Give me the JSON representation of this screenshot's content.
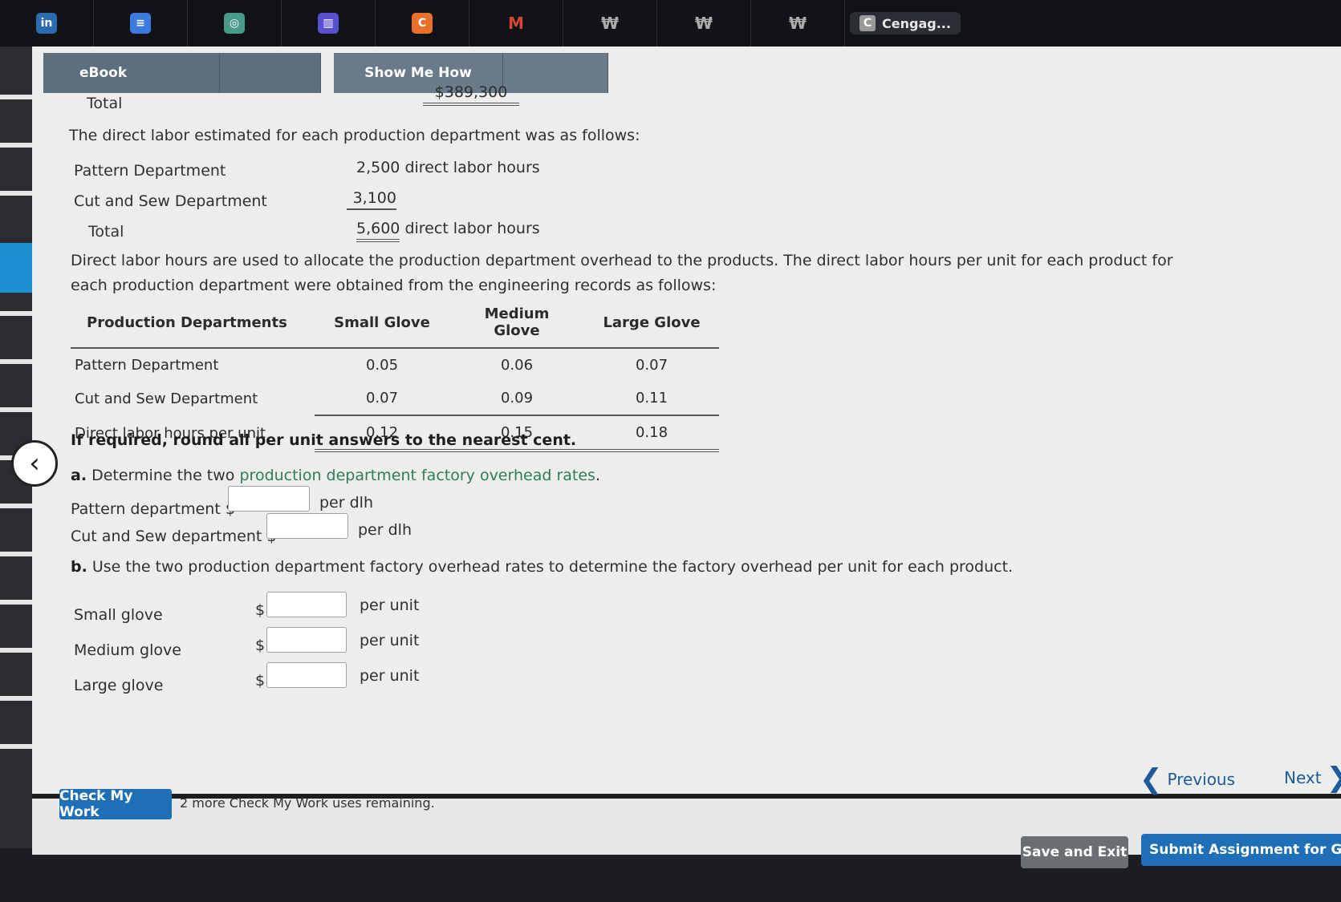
{
  "browser_tabs": {
    "icons": [
      {
        "name": "linkedin-icon",
        "glyph": "in",
        "color": "#2b6cb0"
      },
      {
        "name": "docs-icon",
        "glyph": "≡",
        "color": "#3b7be0"
      },
      {
        "name": "chatgpt-icon",
        "glyph": "◎",
        "color": "#4a9a8a"
      },
      {
        "name": "audio-icon",
        "glyph": "▥",
        "color": "#5a4fcf"
      },
      {
        "name": "cengage-orange-icon",
        "glyph": "C",
        "color": "#e8702a"
      },
      {
        "name": "gmail-icon",
        "glyph": "M",
        "color": "#d44638"
      },
      {
        "name": "university-icon-1",
        "glyph": "₩",
        "color": "#777"
      },
      {
        "name": "university-icon-2",
        "glyph": "₩",
        "color": "#777"
      },
      {
        "name": "university-icon-3",
        "glyph": "₩",
        "color": "#777"
      }
    ],
    "active_tab_label": "Cengag..."
  },
  "tabs": {
    "ebook": "eBook",
    "show_me_how": "Show Me How"
  },
  "overhead": {
    "total_label": "Total",
    "total_value": "$389,300"
  },
  "labor": {
    "intro": "The direct labor estimated for each production department was as follows:",
    "rows": [
      {
        "label": "Pattern Department",
        "value": "2,500",
        "unit": "direct labor hours"
      },
      {
        "label": "Cut and Sew Department",
        "value": "3,100",
        "unit": ""
      }
    ],
    "total_label": "Total",
    "total_value": "5,600",
    "total_unit": "direct labor hours"
  },
  "allocation_text": "Direct labor hours are used to allocate the production department overhead to the products. The direct labor hours per unit for each product for each production department were obtained from the engineering records as follows:",
  "hours_table": {
    "headers": [
      "Production Departments",
      "Small Glove",
      "Medium Glove",
      "Large Glove"
    ],
    "rows": [
      {
        "label": "Pattern Department",
        "values": [
          "0.05",
          "0.06",
          "0.07"
        ]
      },
      {
        "label": "Cut and Sew Department",
        "values": [
          "0.07",
          "0.09",
          "0.11"
        ]
      },
      {
        "label": "Direct labor hours per unit",
        "values": [
          "0.12",
          "0.15",
          "0.18"
        ]
      }
    ]
  },
  "rounding_note": "If required, round all per unit answers to the nearest cent.",
  "part_a": {
    "letter": "a.",
    "prefix": "Determine the two",
    "link": "production department factory overhead rates",
    "suffix": ".",
    "rows": [
      {
        "label": "Pattern department $",
        "unit": "per dlh",
        "value": ""
      },
      {
        "label": "Cut and Sew department $",
        "unit": "per dlh",
        "value": ""
      }
    ]
  },
  "part_b": {
    "letter": "b.",
    "text": "Use the two production department factory overhead rates to determine the factory overhead per unit for each product.",
    "rows": [
      {
        "label": "Small glove",
        "currency": "$",
        "unit": "per unit",
        "value": ""
      },
      {
        "label": "Medium glove",
        "currency": "$",
        "unit": "per unit",
        "value": ""
      },
      {
        "label": "Large glove",
        "currency": "$",
        "unit": "per unit",
        "value": ""
      }
    ]
  },
  "footer": {
    "check_button": "Check My Work",
    "check_note": "2 more Check My Work uses remaining.",
    "previous": "Previous",
    "next": "Next",
    "save_exit": "Save and Exit",
    "submit": "Submit Assignment for Gra"
  }
}
